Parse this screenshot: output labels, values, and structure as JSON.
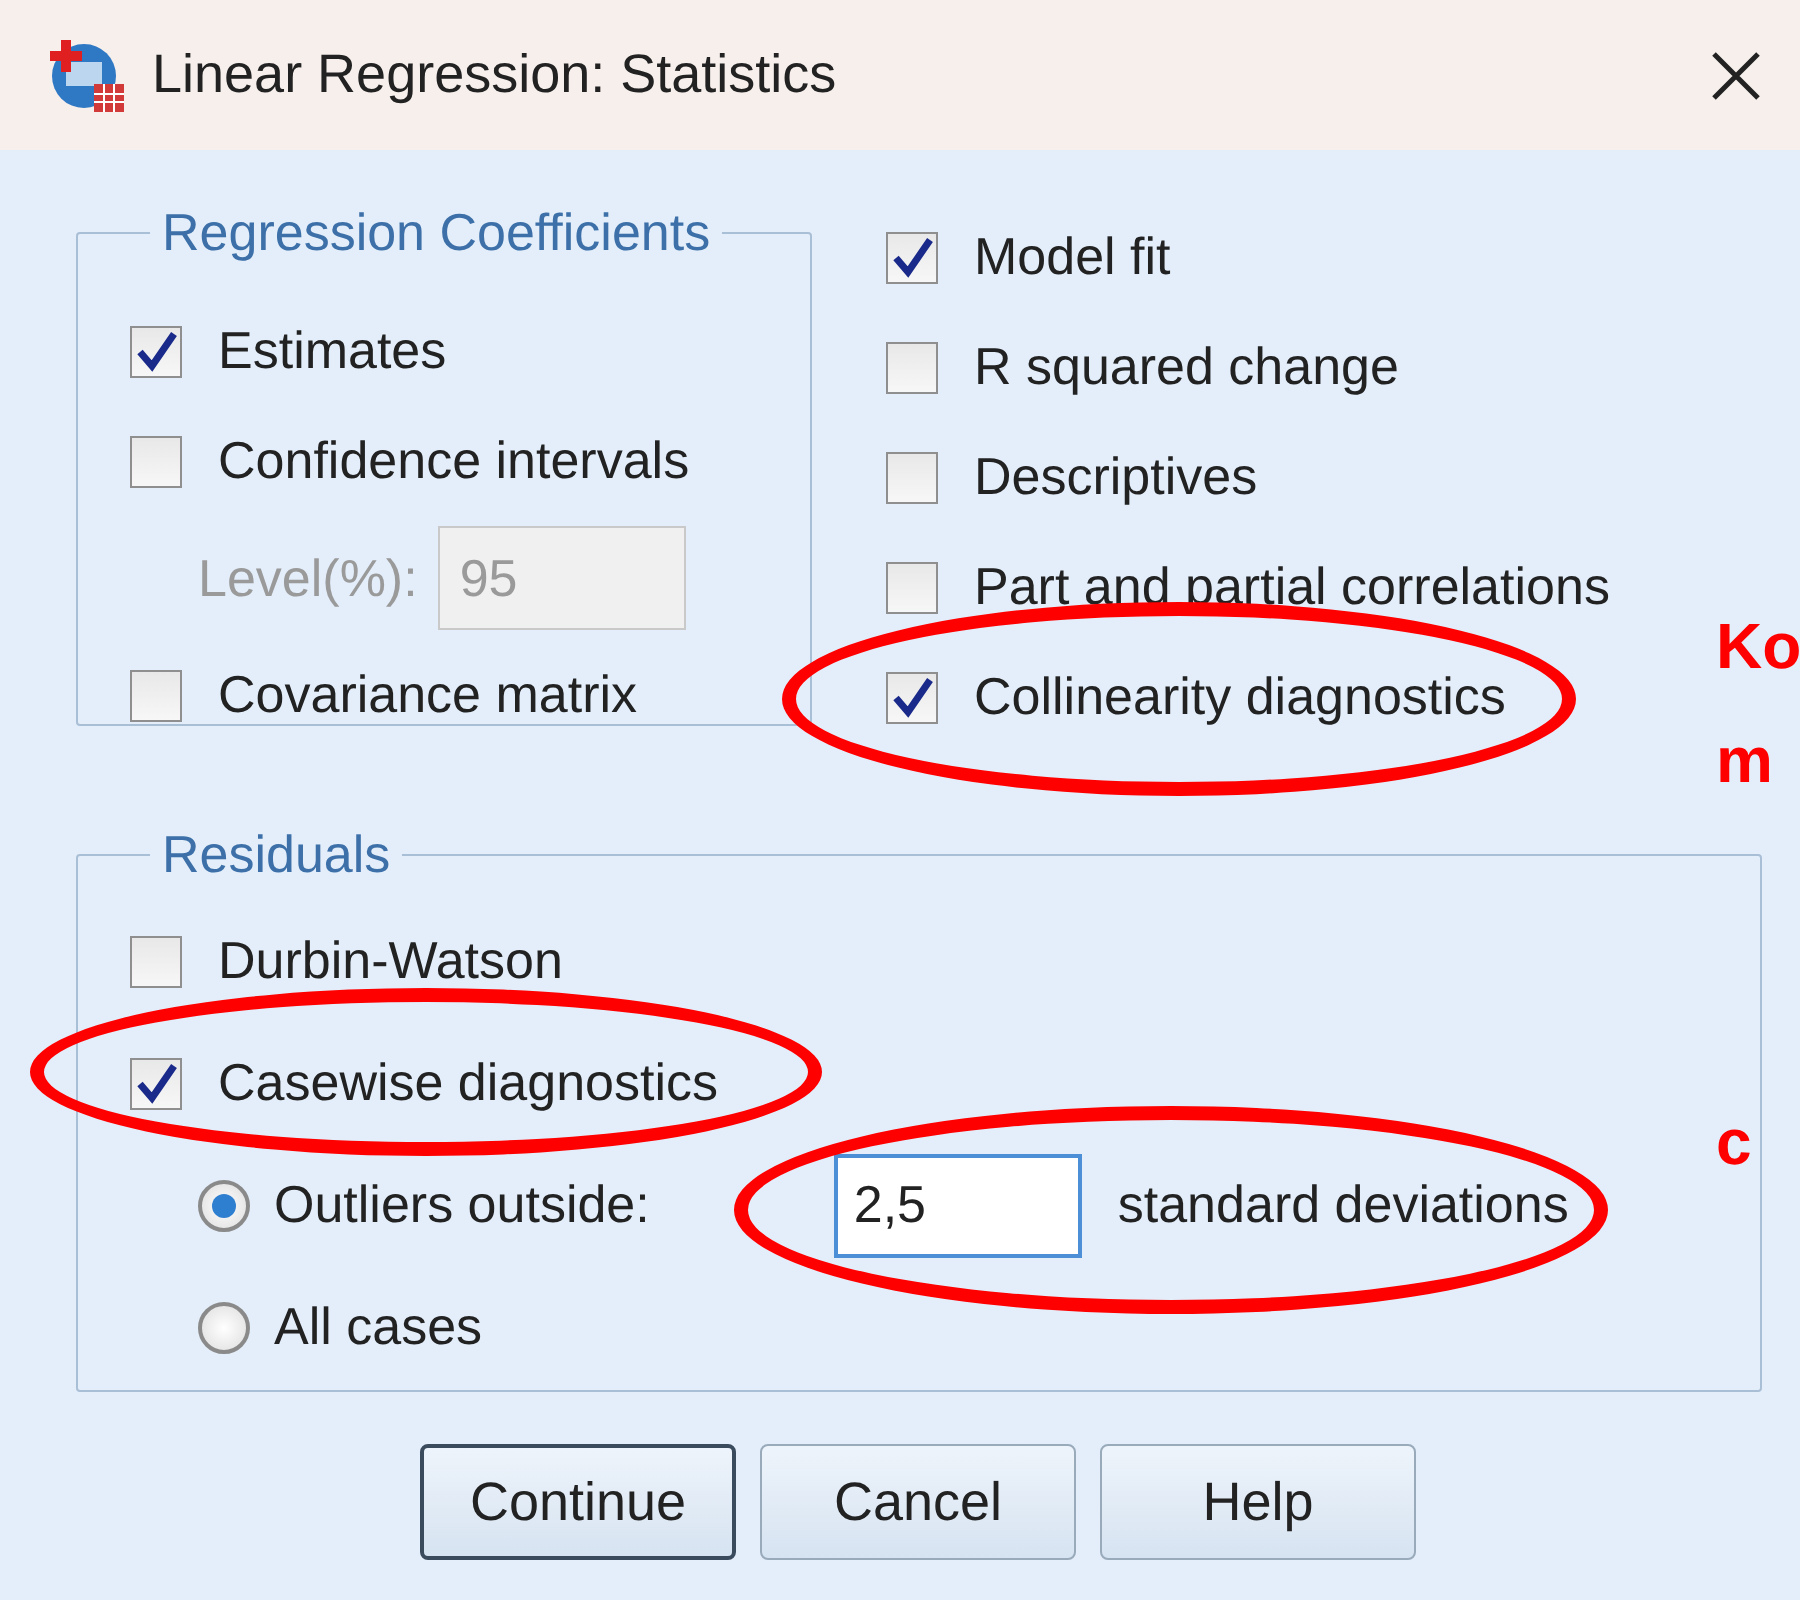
{
  "window": {
    "title": "Linear Regression: Statistics"
  },
  "coefficients": {
    "title": "Regression Coefficients",
    "options": [
      {
        "label": "Estimates",
        "checked": true
      },
      {
        "label": "Confidence intervals",
        "checked": false
      }
    ],
    "level": {
      "label": "Level(%):",
      "value": "95",
      "disabled": true
    },
    "more_options": [
      {
        "label": "Covariance matrix",
        "checked": false
      }
    ]
  },
  "options": [
    {
      "label": "Model fit",
      "checked": true,
      "highlighted": false
    },
    {
      "label": "R squared change",
      "checked": false,
      "highlighted": false
    },
    {
      "label": "Descriptives",
      "checked": false,
      "highlighted": false
    },
    {
      "label": "Part and partial correlations",
      "checked": false,
      "highlighted": false
    },
    {
      "label": "Collinearity diagnostics",
      "checked": true,
      "highlighted": true
    }
  ],
  "residuals": {
    "title": "Residuals",
    "options": [
      {
        "label": "Durbin-Watson",
        "checked": false,
        "highlighted": false
      },
      {
        "label": "Casewise diagnostics",
        "checked": true,
        "highlighted": true
      }
    ],
    "outliers": [
      {
        "label": "Outliers outside:",
        "selected": true
      },
      {
        "label": "All cases",
        "selected": false
      }
    ],
    "threshold": {
      "value": "2,5",
      "unit": "standard deviations",
      "highlighted": true
    }
  },
  "buttons": [
    {
      "label": "Continue",
      "default": true
    },
    {
      "label": "Cancel",
      "default": false
    },
    {
      "label": "Help",
      "default": false
    }
  ],
  "annotations": [
    {
      "text": "Ko"
    },
    {
      "text": "m"
    },
    {
      "text": "c"
    }
  ]
}
